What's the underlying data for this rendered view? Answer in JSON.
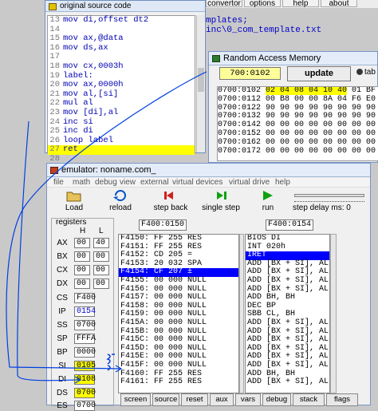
{
  "background_window": {
    "menu": [
      "convertor",
      "options",
      "help",
      "about"
    ],
    "path_lines": [
      "mplates;",
      "inc\\0_com_template.txt"
    ]
  },
  "source_window": {
    "title": "original source code",
    "lines": [
      {
        "num": "13",
        "text": "mov di,offset dt2"
      },
      {
        "num": "14",
        "text": ""
      },
      {
        "num": "15",
        "text": "mov ax,@data"
      },
      {
        "num": "16",
        "text": "mov ds,ax"
      },
      {
        "num": "17",
        "text": ""
      },
      {
        "num": "18",
        "text": "mov cx,0003h"
      },
      {
        "num": "19",
        "text": "label:"
      },
      {
        "num": "20",
        "text": "mov ax,0000h"
      },
      {
        "num": "21",
        "text": "mov al,[si]"
      },
      {
        "num": "22",
        "text": "mul al"
      },
      {
        "num": "23",
        "text": "mov [di],al"
      },
      {
        "num": "24",
        "text": "inc si"
      },
      {
        "num": "25",
        "text": "inc di"
      },
      {
        "num": "26",
        "text": "loop label"
      },
      {
        "num": "27",
        "text": "ret"
      },
      {
        "num": "28",
        "text": ""
      }
    ]
  },
  "ram_window": {
    "title": "Random Access Memory",
    "address": "700:0102",
    "update_label": "update",
    "radio_label": "tab",
    "rows": [
      {
        "addr": "0700:0102",
        "hex": "02 04 08 04 10 40 01 BF"
      },
      {
        "addr": "0700:0112",
        "hex": "00 B8 00 00 8A 04 F6 E0"
      },
      {
        "addr": "0700:0122",
        "hex": "90 90 90 90 90 90 90 90"
      },
      {
        "addr": "0700:0132",
        "hex": "90 90 90 90 90 90 90 90"
      },
      {
        "addr": "0700:0142",
        "hex": "00 00 00 00 00 00 00 00"
      },
      {
        "addr": "0700:0152",
        "hex": "00 00 00 00 00 00 00 00"
      },
      {
        "addr": "0700:0162",
        "hex": "00 00 00 00 00 00 00 00"
      },
      {
        "addr": "0700:0172",
        "hex": "00 00 00 00 00 00 00 00"
      }
    ]
  },
  "emulator": {
    "title": "emulator: noname.com_",
    "menu": [
      "file",
      "math",
      "debug",
      "view",
      "external",
      "virtual devices",
      "virtual drive",
      "help"
    ],
    "toolbar": {
      "load": "Load",
      "reload": "reload",
      "step_back": "step back",
      "single_step": "single step",
      "run": "run",
      "step_delay": "step delay ms: 0"
    },
    "registers_title": "registers",
    "col_h": "H",
    "col_l": "L",
    "registers": [
      {
        "name": "AX",
        "h": "00",
        "l": "40"
      },
      {
        "name": "BX",
        "h": "00",
        "l": "00"
      },
      {
        "name": "CX",
        "h": "00",
        "l": "00"
      },
      {
        "name": "DX",
        "h": "00",
        "l": "00"
      },
      {
        "name": "CS",
        "value": "F400"
      },
      {
        "name": "IP",
        "value": "0154"
      },
      {
        "name": "SS",
        "value": "0700"
      },
      {
        "name": "SP",
        "value": "FFFA"
      },
      {
        "name": "BP",
        "value": "0000"
      },
      {
        "name": "SI",
        "value": "0105"
      },
      {
        "name": "DI",
        "value": "0108"
      },
      {
        "name": "DS",
        "value": "0700"
      },
      {
        "name": "ES",
        "value": "0700"
      }
    ],
    "address_left": "F400:0150",
    "address_right": "F400:0154",
    "listing_left": [
      "F4150: FF 255 RES",
      "F4151: FF 255 RES",
      "F4152: CD 205 =",
      "F4153: 20 032 SPA",
      "F4154: CF 207 ±",
      "F4155: 00 000 NULL",
      "F4156: 00 000 NULL",
      "F4157: 00 000 NULL",
      "F4158: 00 000 NULL",
      "F4159: 00 000 NULL",
      "F415A: 00 000 NULL",
      "F415B: 00 000 NULL",
      "F415C: 00 000 NULL",
      "F415D: 00 000 NULL",
      "F415E: 00 000 NULL",
      "F415F: 00 000 NULL",
      "F4160: FF 255 RES",
      "F4161: FF 255 RES"
    ],
    "listing_right": [
      "BIOS DI",
      "INT 020h",
      "IRET",
      "ADD [BX + SI], AL",
      "ADD [BX + SI], AL",
      "ADD [BX + SI], AL",
      "ADD [BX + SI], AL",
      "ADD BH, BH",
      "DEC BP",
      "SBB CL, BH",
      "ADD [BX + SI], AL",
      "ADD [BX + SI], AL",
      "ADD [BX + SI], AL",
      "ADD [BX + SI], AL",
      "ADD [BX + SI], AL",
      "ADD [BX + SI], AL",
      "ADD BH, BH",
      "ADD [BX + SI], AL"
    ],
    "bottom_buttons": [
      "screen",
      "source",
      "reset",
      "aux",
      "vars",
      "debug",
      "stack",
      "flags"
    ]
  },
  "colors": {
    "highlight": "#ffff00",
    "selection": "#0000ff",
    "code_text": "#0000b4",
    "annotation_arrows": "#0040e0"
  }
}
